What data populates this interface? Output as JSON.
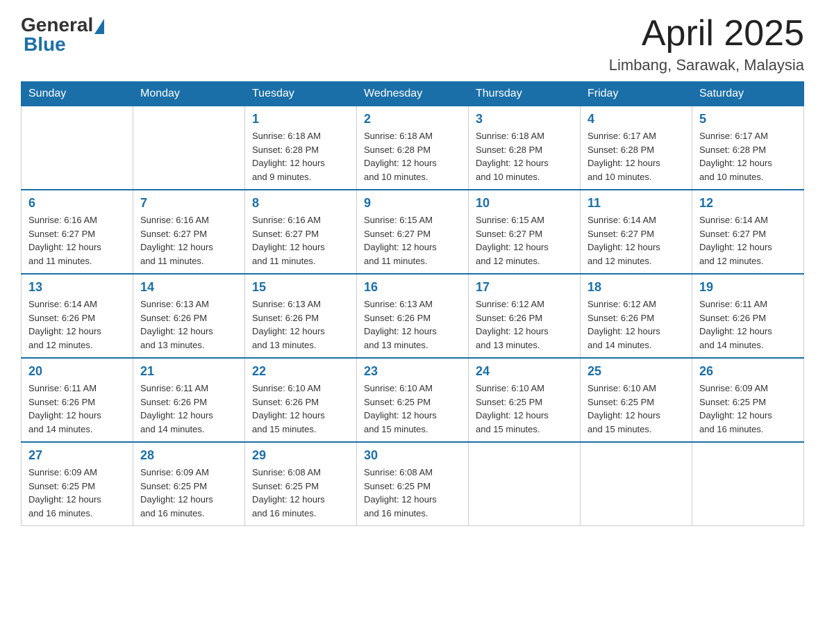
{
  "header": {
    "logo": {
      "general_text": "General",
      "blue_text": "Blue"
    },
    "title": "April 2025",
    "location": "Limbang, Sarawak, Malaysia"
  },
  "calendar": {
    "days_of_week": [
      "Sunday",
      "Monday",
      "Tuesday",
      "Wednesday",
      "Thursday",
      "Friday",
      "Saturday"
    ],
    "weeks": [
      [
        {
          "day": "",
          "info": ""
        },
        {
          "day": "",
          "info": ""
        },
        {
          "day": "1",
          "info": "Sunrise: 6:18 AM\nSunset: 6:28 PM\nDaylight: 12 hours\nand 9 minutes."
        },
        {
          "day": "2",
          "info": "Sunrise: 6:18 AM\nSunset: 6:28 PM\nDaylight: 12 hours\nand 10 minutes."
        },
        {
          "day": "3",
          "info": "Sunrise: 6:18 AM\nSunset: 6:28 PM\nDaylight: 12 hours\nand 10 minutes."
        },
        {
          "day": "4",
          "info": "Sunrise: 6:17 AM\nSunset: 6:28 PM\nDaylight: 12 hours\nand 10 minutes."
        },
        {
          "day": "5",
          "info": "Sunrise: 6:17 AM\nSunset: 6:28 PM\nDaylight: 12 hours\nand 10 minutes."
        }
      ],
      [
        {
          "day": "6",
          "info": "Sunrise: 6:16 AM\nSunset: 6:27 PM\nDaylight: 12 hours\nand 11 minutes."
        },
        {
          "day": "7",
          "info": "Sunrise: 6:16 AM\nSunset: 6:27 PM\nDaylight: 12 hours\nand 11 minutes."
        },
        {
          "day": "8",
          "info": "Sunrise: 6:16 AM\nSunset: 6:27 PM\nDaylight: 12 hours\nand 11 minutes."
        },
        {
          "day": "9",
          "info": "Sunrise: 6:15 AM\nSunset: 6:27 PM\nDaylight: 12 hours\nand 11 minutes."
        },
        {
          "day": "10",
          "info": "Sunrise: 6:15 AM\nSunset: 6:27 PM\nDaylight: 12 hours\nand 12 minutes."
        },
        {
          "day": "11",
          "info": "Sunrise: 6:14 AM\nSunset: 6:27 PM\nDaylight: 12 hours\nand 12 minutes."
        },
        {
          "day": "12",
          "info": "Sunrise: 6:14 AM\nSunset: 6:27 PM\nDaylight: 12 hours\nand 12 minutes."
        }
      ],
      [
        {
          "day": "13",
          "info": "Sunrise: 6:14 AM\nSunset: 6:26 PM\nDaylight: 12 hours\nand 12 minutes."
        },
        {
          "day": "14",
          "info": "Sunrise: 6:13 AM\nSunset: 6:26 PM\nDaylight: 12 hours\nand 13 minutes."
        },
        {
          "day": "15",
          "info": "Sunrise: 6:13 AM\nSunset: 6:26 PM\nDaylight: 12 hours\nand 13 minutes."
        },
        {
          "day": "16",
          "info": "Sunrise: 6:13 AM\nSunset: 6:26 PM\nDaylight: 12 hours\nand 13 minutes."
        },
        {
          "day": "17",
          "info": "Sunrise: 6:12 AM\nSunset: 6:26 PM\nDaylight: 12 hours\nand 13 minutes."
        },
        {
          "day": "18",
          "info": "Sunrise: 6:12 AM\nSunset: 6:26 PM\nDaylight: 12 hours\nand 14 minutes."
        },
        {
          "day": "19",
          "info": "Sunrise: 6:11 AM\nSunset: 6:26 PM\nDaylight: 12 hours\nand 14 minutes."
        }
      ],
      [
        {
          "day": "20",
          "info": "Sunrise: 6:11 AM\nSunset: 6:26 PM\nDaylight: 12 hours\nand 14 minutes."
        },
        {
          "day": "21",
          "info": "Sunrise: 6:11 AM\nSunset: 6:26 PM\nDaylight: 12 hours\nand 14 minutes."
        },
        {
          "day": "22",
          "info": "Sunrise: 6:10 AM\nSunset: 6:26 PM\nDaylight: 12 hours\nand 15 minutes."
        },
        {
          "day": "23",
          "info": "Sunrise: 6:10 AM\nSunset: 6:25 PM\nDaylight: 12 hours\nand 15 minutes."
        },
        {
          "day": "24",
          "info": "Sunrise: 6:10 AM\nSunset: 6:25 PM\nDaylight: 12 hours\nand 15 minutes."
        },
        {
          "day": "25",
          "info": "Sunrise: 6:10 AM\nSunset: 6:25 PM\nDaylight: 12 hours\nand 15 minutes."
        },
        {
          "day": "26",
          "info": "Sunrise: 6:09 AM\nSunset: 6:25 PM\nDaylight: 12 hours\nand 16 minutes."
        }
      ],
      [
        {
          "day": "27",
          "info": "Sunrise: 6:09 AM\nSunset: 6:25 PM\nDaylight: 12 hours\nand 16 minutes."
        },
        {
          "day": "28",
          "info": "Sunrise: 6:09 AM\nSunset: 6:25 PM\nDaylight: 12 hours\nand 16 minutes."
        },
        {
          "day": "29",
          "info": "Sunrise: 6:08 AM\nSunset: 6:25 PM\nDaylight: 12 hours\nand 16 minutes."
        },
        {
          "day": "30",
          "info": "Sunrise: 6:08 AM\nSunset: 6:25 PM\nDaylight: 12 hours\nand 16 minutes."
        },
        {
          "day": "",
          "info": ""
        },
        {
          "day": "",
          "info": ""
        },
        {
          "day": "",
          "info": ""
        }
      ]
    ]
  }
}
